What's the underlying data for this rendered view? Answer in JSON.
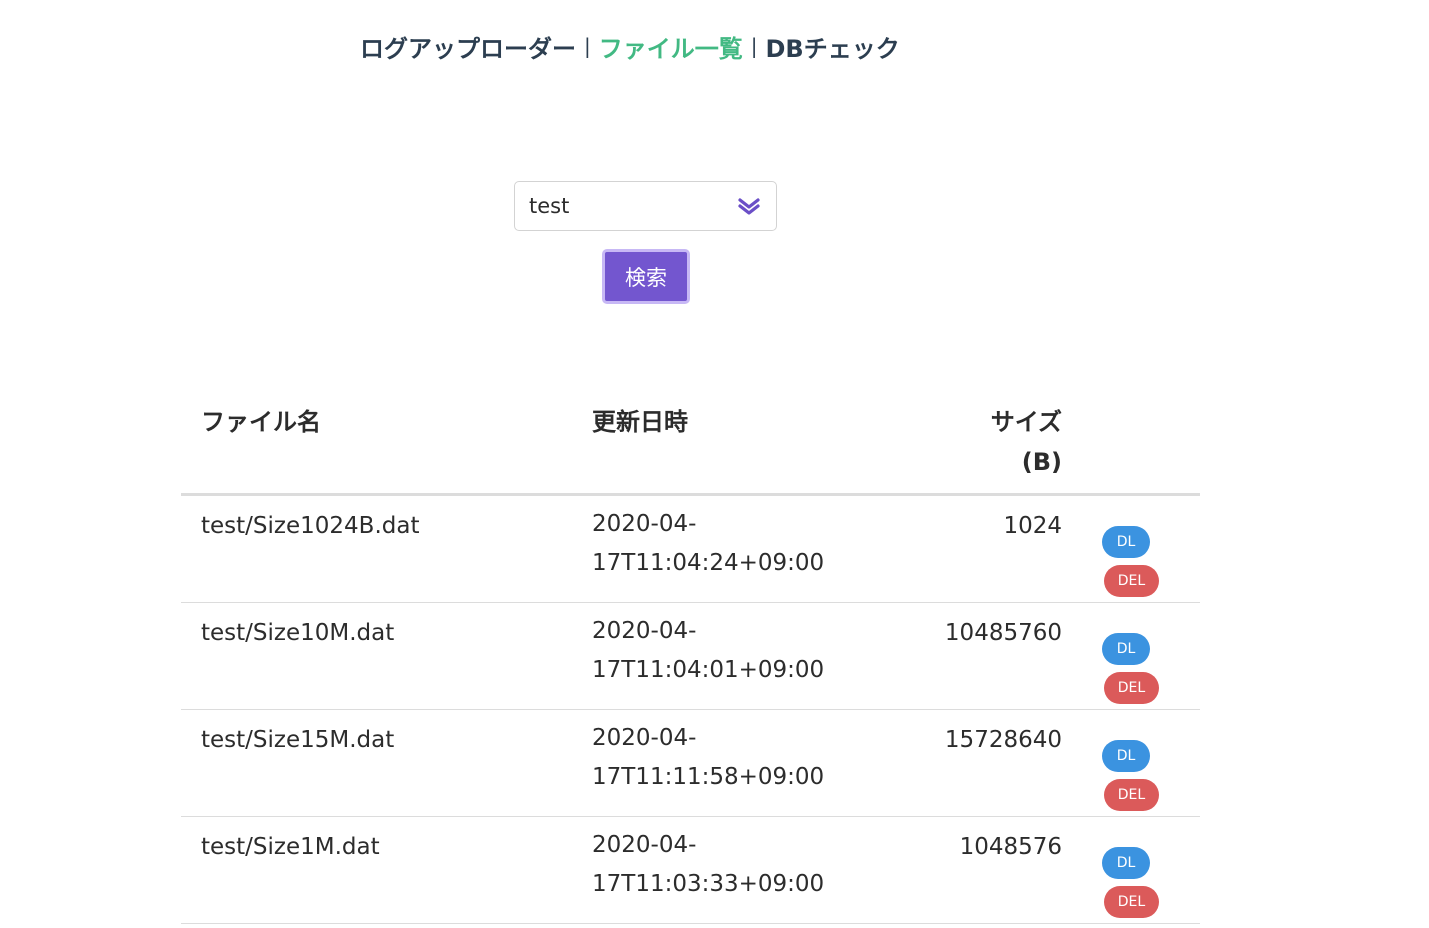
{
  "nav": {
    "items": [
      {
        "label": "ログアップローダー",
        "active": false
      },
      {
        "label": "ファイル一覧",
        "active": true
      },
      {
        "label": "DBチェック",
        "active": false
      }
    ],
    "separator": "|"
  },
  "search": {
    "selected": "test",
    "button_label": "検索"
  },
  "table": {
    "headers": {
      "name": "ファイル名",
      "date": "更新日時",
      "size_line1": "サイズ",
      "size_line2": "(B)"
    },
    "rows": [
      {
        "name": "test/Size1024B.dat",
        "date_line1": "2020-04-",
        "date_line2": "17T11:04:24+09:00",
        "size": "1024",
        "dl": "DL",
        "del": "DEL"
      },
      {
        "name": "test/Size10M.dat",
        "date_line1": "2020-04-",
        "date_line2": "17T11:04:01+09:00",
        "size": "10485760",
        "dl": "DL",
        "del": "DEL"
      },
      {
        "name": "test/Size15M.dat",
        "date_line1": "2020-04-",
        "date_line2": "17T11:11:58+09:00",
        "size": "15728640",
        "dl": "DL",
        "del": "DEL"
      },
      {
        "name": "test/Size1M.dat",
        "date_line1": "2020-04-",
        "date_line2": "17T11:03:33+09:00",
        "size": "1048576",
        "dl": "DL",
        "del": "DEL"
      }
    ]
  },
  "colors": {
    "nav_text": "#2c3e50",
    "nav_active": "#42b983",
    "search_button": "#7356cf",
    "dl_button": "#3b93e0",
    "del_button": "#db5a5a"
  },
  "icons": {
    "select_arrow": "double-chevron-down-icon"
  }
}
